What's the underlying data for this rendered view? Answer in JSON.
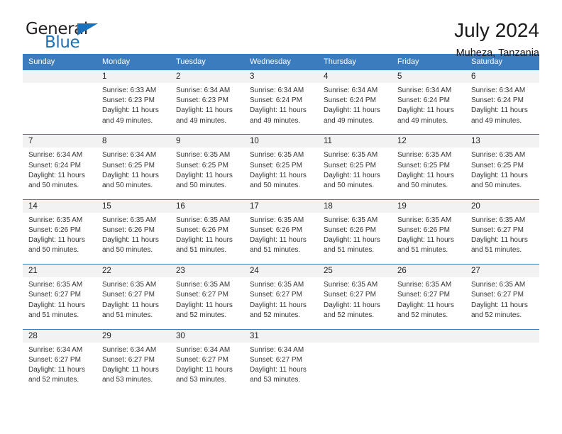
{
  "brand": {
    "name_part1": "General",
    "name_part2": "Blue",
    "triangle_color": "#1d71b8"
  },
  "header": {
    "title": "July 2024",
    "subtitle": "Muheza, Tanzania"
  },
  "theme": {
    "header_blue": "#3b7cbf",
    "day_number_bg": "#f2f2f2",
    "text": "#222222"
  },
  "calendar": {
    "weekday_headers": [
      "Sunday",
      "Monday",
      "Tuesday",
      "Wednesday",
      "Thursday",
      "Friday",
      "Saturday"
    ],
    "weeks": [
      [
        {
          "day": "",
          "sunrise": "",
          "sunset": "",
          "daylight_line1": "",
          "daylight_line2": ""
        },
        {
          "day": "1",
          "sunrise": "Sunrise: 6:33 AM",
          "sunset": "Sunset: 6:23 PM",
          "daylight_line1": "Daylight: 11 hours",
          "daylight_line2": "and 49 minutes."
        },
        {
          "day": "2",
          "sunrise": "Sunrise: 6:34 AM",
          "sunset": "Sunset: 6:23 PM",
          "daylight_line1": "Daylight: 11 hours",
          "daylight_line2": "and 49 minutes."
        },
        {
          "day": "3",
          "sunrise": "Sunrise: 6:34 AM",
          "sunset": "Sunset: 6:24 PM",
          "daylight_line1": "Daylight: 11 hours",
          "daylight_line2": "and 49 minutes."
        },
        {
          "day": "4",
          "sunrise": "Sunrise: 6:34 AM",
          "sunset": "Sunset: 6:24 PM",
          "daylight_line1": "Daylight: 11 hours",
          "daylight_line2": "and 49 minutes."
        },
        {
          "day": "5",
          "sunrise": "Sunrise: 6:34 AM",
          "sunset": "Sunset: 6:24 PM",
          "daylight_line1": "Daylight: 11 hours",
          "daylight_line2": "and 49 minutes."
        },
        {
          "day": "6",
          "sunrise": "Sunrise: 6:34 AM",
          "sunset": "Sunset: 6:24 PM",
          "daylight_line1": "Daylight: 11 hours",
          "daylight_line2": "and 49 minutes."
        }
      ],
      [
        {
          "day": "7",
          "sunrise": "Sunrise: 6:34 AM",
          "sunset": "Sunset: 6:24 PM",
          "daylight_line1": "Daylight: 11 hours",
          "daylight_line2": "and 50 minutes."
        },
        {
          "day": "8",
          "sunrise": "Sunrise: 6:34 AM",
          "sunset": "Sunset: 6:25 PM",
          "daylight_line1": "Daylight: 11 hours",
          "daylight_line2": "and 50 minutes."
        },
        {
          "day": "9",
          "sunrise": "Sunrise: 6:35 AM",
          "sunset": "Sunset: 6:25 PM",
          "daylight_line1": "Daylight: 11 hours",
          "daylight_line2": "and 50 minutes."
        },
        {
          "day": "10",
          "sunrise": "Sunrise: 6:35 AM",
          "sunset": "Sunset: 6:25 PM",
          "daylight_line1": "Daylight: 11 hours",
          "daylight_line2": "and 50 minutes."
        },
        {
          "day": "11",
          "sunrise": "Sunrise: 6:35 AM",
          "sunset": "Sunset: 6:25 PM",
          "daylight_line1": "Daylight: 11 hours",
          "daylight_line2": "and 50 minutes."
        },
        {
          "day": "12",
          "sunrise": "Sunrise: 6:35 AM",
          "sunset": "Sunset: 6:25 PM",
          "daylight_line1": "Daylight: 11 hours",
          "daylight_line2": "and 50 minutes."
        },
        {
          "day": "13",
          "sunrise": "Sunrise: 6:35 AM",
          "sunset": "Sunset: 6:25 PM",
          "daylight_line1": "Daylight: 11 hours",
          "daylight_line2": "and 50 minutes."
        }
      ],
      [
        {
          "day": "14",
          "sunrise": "Sunrise: 6:35 AM",
          "sunset": "Sunset: 6:26 PM",
          "daylight_line1": "Daylight: 11 hours",
          "daylight_line2": "and 50 minutes."
        },
        {
          "day": "15",
          "sunrise": "Sunrise: 6:35 AM",
          "sunset": "Sunset: 6:26 PM",
          "daylight_line1": "Daylight: 11 hours",
          "daylight_line2": "and 50 minutes."
        },
        {
          "day": "16",
          "sunrise": "Sunrise: 6:35 AM",
          "sunset": "Sunset: 6:26 PM",
          "daylight_line1": "Daylight: 11 hours",
          "daylight_line2": "and 51 minutes."
        },
        {
          "day": "17",
          "sunrise": "Sunrise: 6:35 AM",
          "sunset": "Sunset: 6:26 PM",
          "daylight_line1": "Daylight: 11 hours",
          "daylight_line2": "and 51 minutes."
        },
        {
          "day": "18",
          "sunrise": "Sunrise: 6:35 AM",
          "sunset": "Sunset: 6:26 PM",
          "daylight_line1": "Daylight: 11 hours",
          "daylight_line2": "and 51 minutes."
        },
        {
          "day": "19",
          "sunrise": "Sunrise: 6:35 AM",
          "sunset": "Sunset: 6:26 PM",
          "daylight_line1": "Daylight: 11 hours",
          "daylight_line2": "and 51 minutes."
        },
        {
          "day": "20",
          "sunrise": "Sunrise: 6:35 AM",
          "sunset": "Sunset: 6:27 PM",
          "daylight_line1": "Daylight: 11 hours",
          "daylight_line2": "and 51 minutes."
        }
      ],
      [
        {
          "day": "21",
          "sunrise": "Sunrise: 6:35 AM",
          "sunset": "Sunset: 6:27 PM",
          "daylight_line1": "Daylight: 11 hours",
          "daylight_line2": "and 51 minutes."
        },
        {
          "day": "22",
          "sunrise": "Sunrise: 6:35 AM",
          "sunset": "Sunset: 6:27 PM",
          "daylight_line1": "Daylight: 11 hours",
          "daylight_line2": "and 51 minutes."
        },
        {
          "day": "23",
          "sunrise": "Sunrise: 6:35 AM",
          "sunset": "Sunset: 6:27 PM",
          "daylight_line1": "Daylight: 11 hours",
          "daylight_line2": "and 52 minutes."
        },
        {
          "day": "24",
          "sunrise": "Sunrise: 6:35 AM",
          "sunset": "Sunset: 6:27 PM",
          "daylight_line1": "Daylight: 11 hours",
          "daylight_line2": "and 52 minutes."
        },
        {
          "day": "25",
          "sunrise": "Sunrise: 6:35 AM",
          "sunset": "Sunset: 6:27 PM",
          "daylight_line1": "Daylight: 11 hours",
          "daylight_line2": "and 52 minutes."
        },
        {
          "day": "26",
          "sunrise": "Sunrise: 6:35 AM",
          "sunset": "Sunset: 6:27 PM",
          "daylight_line1": "Daylight: 11 hours",
          "daylight_line2": "and 52 minutes."
        },
        {
          "day": "27",
          "sunrise": "Sunrise: 6:35 AM",
          "sunset": "Sunset: 6:27 PM",
          "daylight_line1": "Daylight: 11 hours",
          "daylight_line2": "and 52 minutes."
        }
      ],
      [
        {
          "day": "28",
          "sunrise": "Sunrise: 6:34 AM",
          "sunset": "Sunset: 6:27 PM",
          "daylight_line1": "Daylight: 11 hours",
          "daylight_line2": "and 52 minutes."
        },
        {
          "day": "29",
          "sunrise": "Sunrise: 6:34 AM",
          "sunset": "Sunset: 6:27 PM",
          "daylight_line1": "Daylight: 11 hours",
          "daylight_line2": "and 53 minutes."
        },
        {
          "day": "30",
          "sunrise": "Sunrise: 6:34 AM",
          "sunset": "Sunset: 6:27 PM",
          "daylight_line1": "Daylight: 11 hours",
          "daylight_line2": "and 53 minutes."
        },
        {
          "day": "31",
          "sunrise": "Sunrise: 6:34 AM",
          "sunset": "Sunset: 6:27 PM",
          "daylight_line1": "Daylight: 11 hours",
          "daylight_line2": "and 53 minutes."
        },
        {
          "day": "",
          "sunrise": "",
          "sunset": "",
          "daylight_line1": "",
          "daylight_line2": ""
        },
        {
          "day": "",
          "sunrise": "",
          "sunset": "",
          "daylight_line1": "",
          "daylight_line2": ""
        },
        {
          "day": "",
          "sunrise": "",
          "sunset": "",
          "daylight_line1": "",
          "daylight_line2": ""
        }
      ]
    ]
  }
}
